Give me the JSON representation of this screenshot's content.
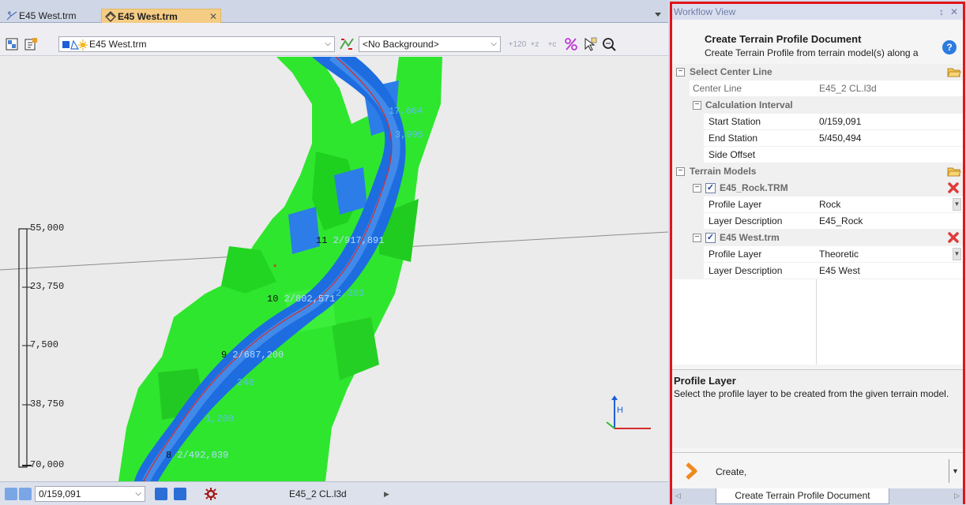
{
  "tabs": [
    {
      "label": "E45 West.trm",
      "active": false
    },
    {
      "label": "E45 West.trm",
      "active": true
    }
  ],
  "toolbar": {
    "terrain_combo": "E45 West.trm",
    "background_combo": "<No Background>",
    "dim_labels": [
      "+120",
      "+z",
      "+c"
    ]
  },
  "viewport": {
    "scale_labels": [
      "55,000",
      "23,750",
      "7,500",
      "38,750",
      "70,000"
    ],
    "stations": [
      {
        "num": "11",
        "label": "2/917,891"
      },
      {
        "num": "10",
        "label": "2/802,571"
      },
      {
        "num": "9",
        "label": "2/687,200"
      },
      {
        "num": "8",
        "label": "2/492,039"
      }
    ],
    "faded_labels": [
      "17,664",
      "3,995",
      "2,303",
      "246",
      "1,200"
    ],
    "axis_label": "H"
  },
  "nav": {
    "station": "0/159,091",
    "center_line": "E45_2 CL.l3d"
  },
  "workflow": {
    "title": "Workflow View",
    "controls": [
      "↕",
      "✕"
    ],
    "header_title": "Create Terrain Profile Document",
    "header_desc": "Create Terrain Profile from terrain model(s) along a",
    "grid": {
      "select_center_line": "Select Center Line",
      "center_line_label": "Center Line",
      "center_line_value": "E45_2 CL.l3d",
      "calc_interval": "Calculation Interval",
      "start_station_label": "Start Station",
      "start_station_value": "0/159,091",
      "end_station_label": "End Station",
      "end_station_value": "5/450,494",
      "side_offset_label": "Side Offset",
      "side_offset_value": "",
      "terrain_models": "Terrain Models",
      "model1_name": "E45_Rock.TRM",
      "model1_profile_layer_label": "Profile Layer",
      "model1_profile_layer_value": "Rock",
      "model1_layer_desc_label": "Layer Description",
      "model1_layer_desc_value": "E45_Rock",
      "model2_name": "E45 West.trm",
      "model2_profile_layer_label": "Profile Layer",
      "model2_profile_layer_value": "Theoretic",
      "model2_layer_desc_label": "Layer Description",
      "model2_layer_desc_value": "E45 West"
    },
    "description_title": "Profile Layer",
    "description_text": "Select the profile layer to be created from the given terrain model.",
    "create_label": "Create,",
    "bottom_tab": "Create Terrain Profile Document"
  },
  "colors": {
    "accent_red": "#e0151b",
    "terrain_green": "#2ee82e",
    "road_blue": "#1f6fe0",
    "active_tab": "#f5cc84"
  }
}
